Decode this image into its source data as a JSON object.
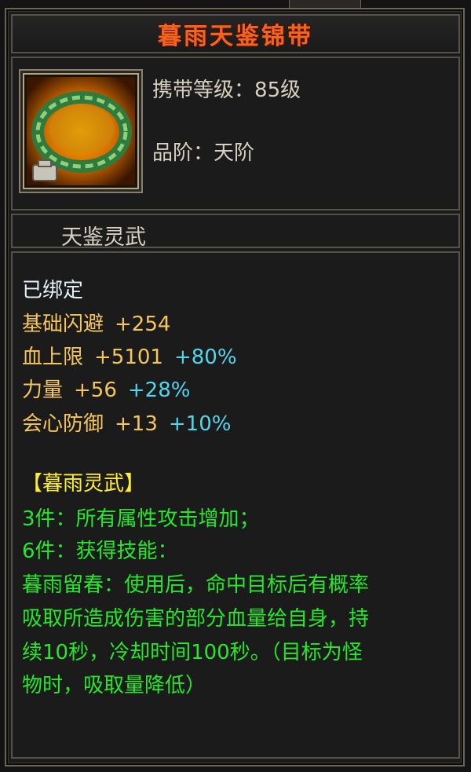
{
  "item": {
    "name": "暮雨天鉴锦带",
    "carry_level_label": "携带等级",
    "carry_level_value": "85级",
    "grade_label": "品阶",
    "grade_value": "天阶",
    "colon": "："
  },
  "set_name": "天鉴灵武",
  "bound_text": "已绑定",
  "stats": [
    {
      "name": "基础闪避",
      "value": "+254",
      "percent": ""
    },
    {
      "name": "血上限",
      "value": "+5101",
      "percent": "+80%"
    },
    {
      "name": "力量",
      "value": "+56",
      "percent": "+28%"
    },
    {
      "name": "会心防御",
      "value": "+13",
      "percent": "+10%"
    }
  ],
  "set_bonus": {
    "header": "【暮雨灵武】",
    "lines": [
      "3件：所有属性攻击增加；",
      "6件：获得技能：",
      "暮雨留春：使用后，命中目标后有概率",
      "吸取所造成伤害的部分血量给自身，持",
      "续10秒，冷却时间100秒。（目标为怪",
      "物时，吸取量降低）"
    ]
  },
  "colors": {
    "title": "#f3641c",
    "stat_label": "#f6c65a",
    "percent": "#52d6ee",
    "set_header": "#ffef2a",
    "set_text": "#25e82a",
    "bound": "#e6f0f6"
  }
}
